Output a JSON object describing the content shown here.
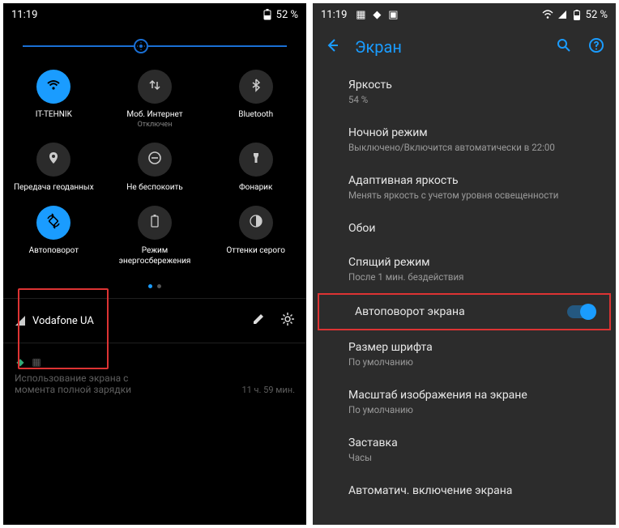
{
  "left": {
    "status": {
      "time": "11:19",
      "battery": "52 %"
    },
    "tiles": [
      {
        "label": "IT-TEHNIK",
        "sub": "",
        "icon": "wifi-icon",
        "on": true
      },
      {
        "label": "Моб. Интернет",
        "sub": "Отключен",
        "icon": "data-arrows-icon",
        "on": false
      },
      {
        "label": "Bluetooth",
        "sub": "",
        "icon": "bluetooth-icon",
        "on": false
      },
      {
        "label": "Передача геоданных",
        "sub": "",
        "icon": "location-icon",
        "on": false
      },
      {
        "label": "Не беспокоить",
        "sub": "",
        "icon": "dnd-icon",
        "on": false
      },
      {
        "label": "Фонарик",
        "sub": "",
        "icon": "flashlight-icon",
        "on": false
      },
      {
        "label": "Автоповорот",
        "sub": "",
        "icon": "rotate-icon",
        "on": true
      },
      {
        "label": "Режим энергосбережения",
        "sub": "",
        "icon": "battery-icon",
        "on": false
      },
      {
        "label": "Оттенки серого",
        "sub": "",
        "icon": "grayscale-icon",
        "on": false
      }
    ],
    "carrier": "Vodafone UA",
    "notif": {
      "text1": "Использование экрана с",
      "text2": "момента полной зарядки",
      "time": "11 ч. 59 мин."
    }
  },
  "right": {
    "status": {
      "time": "11:19",
      "battery": "52 %"
    },
    "title": "Экран",
    "items": [
      {
        "t": "Яркость",
        "s": "54 %"
      },
      {
        "t": "Ночной режим",
        "s": "Выключено/Включится автоматически в 22:00"
      },
      {
        "t": "Адаптивная яркость",
        "s": "Менять яркость с учетом уровня освещенности"
      },
      {
        "t": "Обои",
        "s": ""
      },
      {
        "t": "Спящий режим",
        "s": "После 1 мин. бездействия"
      },
      {
        "t": "Автоповорот экрана",
        "s": "",
        "toggle": true,
        "hl": true
      },
      {
        "t": "Размер шрифта",
        "s": "По умолчанию"
      },
      {
        "t": "Масштаб изображения на экране",
        "s": "По умолчанию"
      },
      {
        "t": "Заставка",
        "s": "Часы"
      },
      {
        "t": "Автоматич. включение экрана",
        "s": ""
      }
    ]
  }
}
